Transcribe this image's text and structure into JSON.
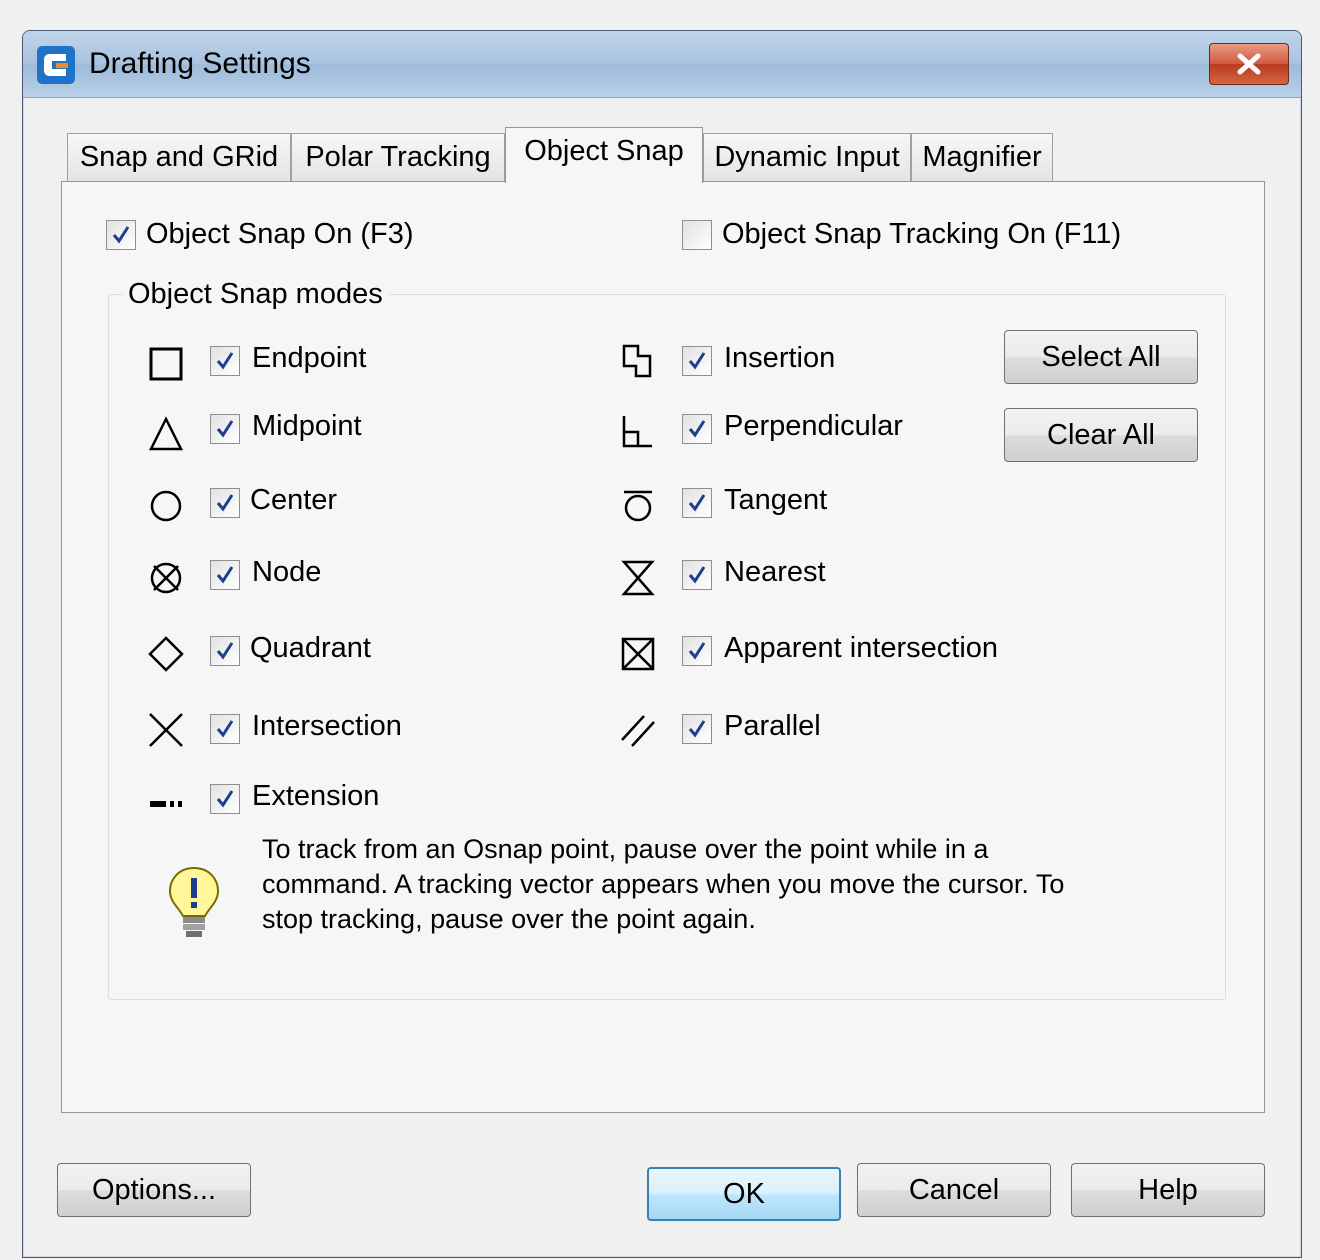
{
  "window": {
    "title": "Drafting Settings",
    "close_label": "X"
  },
  "tabs": [
    {
      "label": "Snap and GRid",
      "active": false
    },
    {
      "label": "Polar Tracking",
      "active": false
    },
    {
      "label": "Object Snap",
      "active": true
    },
    {
      "label": "Dynamic Input",
      "active": false
    },
    {
      "label": "Magnifier",
      "active": false
    }
  ],
  "object_snap": {
    "snap_on": {
      "label": "Object Snap On (F3)",
      "checked": true
    },
    "tracking_on": {
      "label": "Object Snap Tracking On (F11)",
      "checked": false
    },
    "modes_title": "Object Snap modes",
    "left_modes": [
      {
        "label": "Endpoint",
        "icon": "endpoint-icon",
        "checked": true
      },
      {
        "label": "Midpoint",
        "icon": "midpoint-icon",
        "checked": true
      },
      {
        "label": "Center",
        "icon": "center-icon",
        "checked": true
      },
      {
        "label": "Node",
        "icon": "node-icon",
        "checked": true
      },
      {
        "label": "Quadrant",
        "icon": "quadrant-icon",
        "checked": true
      },
      {
        "label": "Intersection",
        "icon": "intersection-icon",
        "checked": true
      },
      {
        "label": "Extension",
        "icon": "extension-icon",
        "checked": true
      }
    ],
    "right_modes": [
      {
        "label": "Insertion",
        "icon": "insertion-icon",
        "checked": true
      },
      {
        "label": "Perpendicular",
        "icon": "perpendicular-icon",
        "checked": true
      },
      {
        "label": "Tangent",
        "icon": "tangent-icon",
        "checked": true
      },
      {
        "label": "Nearest",
        "icon": "nearest-icon",
        "checked": true
      },
      {
        "label": "Apparent intersection",
        "icon": "apparent-intersection-icon",
        "checked": true
      },
      {
        "label": "Parallel",
        "icon": "parallel-icon",
        "checked": true
      }
    ],
    "select_all": "Select All",
    "clear_all": "Clear All",
    "hint_lines": [
      "To track from an Osnap point, pause over the point while in a",
      "command.  A tracking vector appears when you move the cursor.  To",
      "stop tracking, pause over the point again."
    ]
  },
  "footer": {
    "options": "Options...",
    "ok": "OK",
    "cancel": "Cancel",
    "help": "Help"
  },
  "colors": {
    "titlebar": "#a9c3df",
    "close": "#cf5a3e",
    "default_button_border": "#3c7fb1"
  }
}
